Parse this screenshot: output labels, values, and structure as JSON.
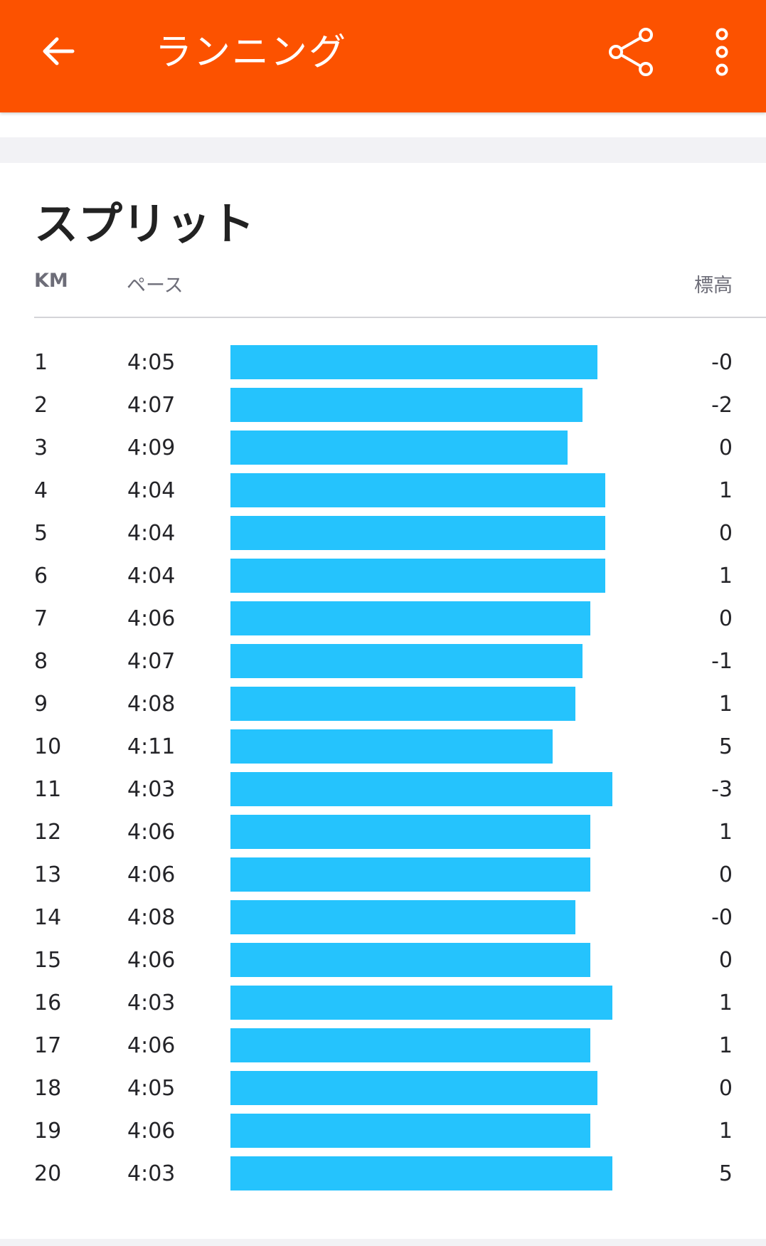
{
  "appbar": {
    "title": "ランニング",
    "back_icon": "arrow-left-icon",
    "share_icon": "share-icon",
    "more_icon": "more-vertical-icon",
    "background": "#fc5200"
  },
  "splits": {
    "title": "スプリット",
    "headers": {
      "km": "KM",
      "pace": "ペース",
      "elevation": "標高"
    },
    "bar_color": "#25c3fd",
    "rows": [
      {
        "km": "1",
        "pace": "4:05",
        "elevation": "-0"
      },
      {
        "km": "2",
        "pace": "4:07",
        "elevation": "-2"
      },
      {
        "km": "3",
        "pace": "4:09",
        "elevation": "0"
      },
      {
        "km": "4",
        "pace": "4:04",
        "elevation": "1"
      },
      {
        "km": "5",
        "pace": "4:04",
        "elevation": "0"
      },
      {
        "km": "6",
        "pace": "4:04",
        "elevation": "1"
      },
      {
        "km": "7",
        "pace": "4:06",
        "elevation": "0"
      },
      {
        "km": "8",
        "pace": "4:07",
        "elevation": "-1"
      },
      {
        "km": "9",
        "pace": "4:08",
        "elevation": "1"
      },
      {
        "km": "10",
        "pace": "4:11",
        "elevation": "5"
      },
      {
        "km": "11",
        "pace": "4:03",
        "elevation": "-3"
      },
      {
        "km": "12",
        "pace": "4:06",
        "elevation": "1"
      },
      {
        "km": "13",
        "pace": "4:06",
        "elevation": "0"
      },
      {
        "km": "14",
        "pace": "4:08",
        "elevation": "-0"
      },
      {
        "km": "15",
        "pace": "4:06",
        "elevation": "0"
      },
      {
        "km": "16",
        "pace": "4:03",
        "elevation": "1"
      },
      {
        "km": "17",
        "pace": "4:06",
        "elevation": "1"
      },
      {
        "km": "18",
        "pace": "4:05",
        "elevation": "0"
      },
      {
        "km": "19",
        "pace": "4:06",
        "elevation": "1"
      },
      {
        "km": "20",
        "pace": "4:03",
        "elevation": "5"
      }
    ]
  }
}
